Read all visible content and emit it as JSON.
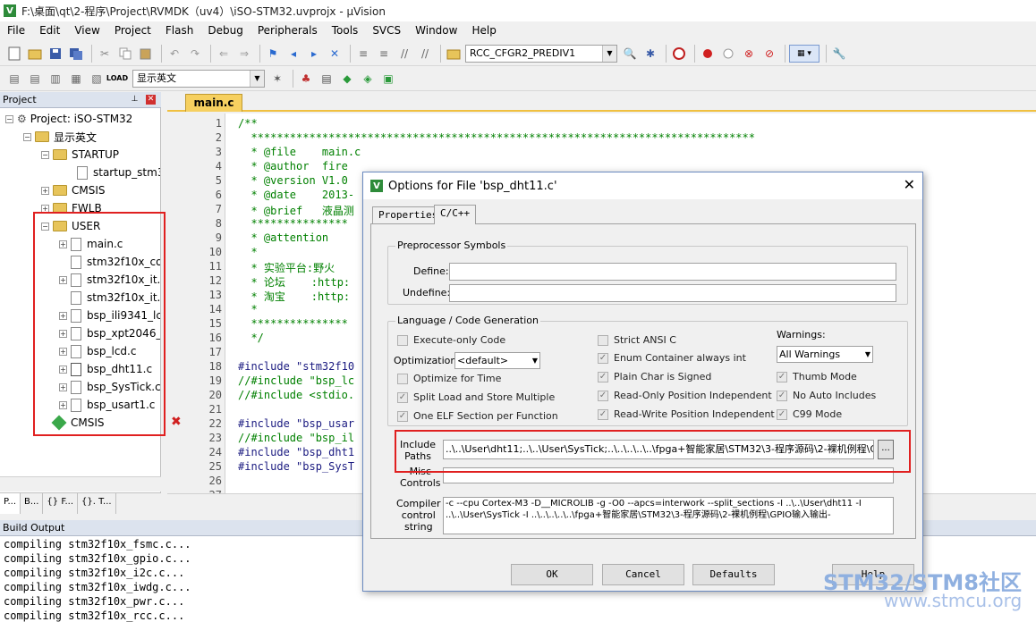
{
  "window": {
    "title": "F:\\桌面\\qt\\2-程序\\Project\\RVMDK（uv4）\\iSO-STM32.uvprojx - µVision"
  },
  "menu": [
    "File",
    "Edit",
    "View",
    "Project",
    "Flash",
    "Debug",
    "Peripherals",
    "Tools",
    "SVCS",
    "Window",
    "Help"
  ],
  "toolbar": {
    "target_combo": "RCC_CFGR2_PREDIV1",
    "group_combo": "显示英文"
  },
  "project_panel": {
    "title": "Project",
    "tree": {
      "root": "Project: iSO-STM32",
      "group": "显示英文",
      "startup": "STARTUP",
      "startup_file": "startup_stm32",
      "cmsis": "CMSIS",
      "fwlb": "FWLB",
      "user": "USER",
      "cmsis2": "CMSIS",
      "user_files": [
        "main.c",
        "stm32f10x_co",
        "stm32f10x_it.c",
        "stm32f10x_it.h",
        "bsp_ili9341_lc",
        "bsp_xpt2046_l",
        "bsp_lcd.c",
        "bsp_dht11.c",
        "bsp_SysTick.c",
        "bsp_usart1.c"
      ]
    },
    "tabs": [
      "P...",
      "B...",
      "{} F...",
      "{}. T..."
    ]
  },
  "editor": {
    "tab": "main.c",
    "lines": [
      {
        "n": "1",
        "t": "/**",
        "c": "cm"
      },
      {
        "n": "2",
        "t": "  ******************************************************************************",
        "c": "cm"
      },
      {
        "n": "3",
        "t": "  * @file    main.c",
        "c": "cm"
      },
      {
        "n": "4",
        "t": "  * @author  fire",
        "c": "cm"
      },
      {
        "n": "5",
        "t": "  * @version V1.0",
        "c": "cm"
      },
      {
        "n": "6",
        "t": "  * @date    2013-",
        "c": "cm"
      },
      {
        "n": "7",
        "t": "  * @brief   液晶测",
        "c": "cm"
      },
      {
        "n": "8",
        "t": "  ***************",
        "c": "cm"
      },
      {
        "n": "9",
        "t": "  * @attention",
        "c": "cm"
      },
      {
        "n": "10",
        "t": "  *",
        "c": "cm"
      },
      {
        "n": "11",
        "t": "  * 实验平台:野火",
        "c": "cm"
      },
      {
        "n": "12",
        "t": "  * 论坛    :http:",
        "c": "cm"
      },
      {
        "n": "13",
        "t": "  * 淘宝    :http:",
        "c": "cm"
      },
      {
        "n": "14",
        "t": "  *",
        "c": "cm"
      },
      {
        "n": "15",
        "t": "  ***************",
        "c": "cm"
      },
      {
        "n": "16",
        "t": "  */",
        "c": "cm"
      },
      {
        "n": "17",
        "t": "",
        "c": "pp"
      },
      {
        "n": "18",
        "t": "#include \"stm32f10",
        "c": "pp"
      },
      {
        "n": "19",
        "t": "//#include \"bsp_lc",
        "c": "cm"
      },
      {
        "n": "20",
        "t": "//#include <stdio.",
        "c": "cm"
      },
      {
        "n": "21",
        "t": "",
        "c": "pp"
      },
      {
        "n": "22",
        "t": "#include \"bsp_usar",
        "c": "pp"
      },
      {
        "n": "23",
        "t": "//#include \"bsp_il",
        "c": "cm"
      },
      {
        "n": "24",
        "t": "#include \"bsp_dht1",
        "c": "pp"
      },
      {
        "n": "25",
        "t": "#include \"bsp_SysT",
        "c": "pp"
      },
      {
        "n": "26",
        "t": "",
        "c": "pp"
      },
      {
        "n": "27",
        "t": "",
        "c": "pp"
      }
    ]
  },
  "build_output": {
    "title": "Build Output",
    "lines": [
      "compiling stm32f10x_fsmc.c...",
      "compiling stm32f10x_gpio.c...",
      "compiling stm32f10x_i2c.c...",
      "compiling stm32f10x_iwdg.c...",
      "compiling stm32f10x_pwr.c...",
      "compiling stm32f10x_rcc.c..."
    ]
  },
  "dialog": {
    "title": "Options for File 'bsp_dht11.c'",
    "tabs": [
      "Properties",
      "C/C++"
    ],
    "preprocessor": {
      "title": "Preprocessor Symbols",
      "define_label": "Define:",
      "undefine_label": "Undefine:",
      "define_value": "",
      "undefine_value": ""
    },
    "language": {
      "title": "Language / Code Generation",
      "execute_only": "Execute-only Code",
      "optimization_label": "Optimization:",
      "optimization_value": "<default>",
      "optimize_time": "Optimize for Time",
      "split_load": "Split Load and Store Multiple",
      "one_elf": "One ELF Section per Function",
      "strict_ansi": "Strict ANSI C",
      "enum_int": "Enum Container always int",
      "plain_char": "Plain Char is Signed",
      "ro_pos": "Read-Only Position Independent",
      "rw_pos": "Read-Write Position Independent",
      "warnings_label": "Warnings:",
      "warnings_value": "All Warnings",
      "thumb": "Thumb Mode",
      "no_auto": "No Auto Includes",
      "c99": "C99 Mode"
    },
    "include_label": "Include\nPaths",
    "include_value": "..\\..\\User\\dht11;..\\..\\User\\SysTick;..\\..\\..\\..\\..\\fpga+智能家居\\STM32\\3-程序源码\\2-裸机例程\\G",
    "misc_label": "Misc\nControls",
    "misc_value": "",
    "compiler_label": "Compiler\ncontrol\nstring",
    "compiler_value": "-c --cpu Cortex-M3 -D__MICROLIB -g -O0 --apcs=interwork --split_sections -I ..\\..\\User\\dht11 -I ..\\..\\User\\SysTick -I ..\\..\\..\\..\\..\\fpga+智能家居\\STM32\\3-程序源码\\2-裸机例程\\GPIO输入输出-",
    "buttons": {
      "ok": "OK",
      "cancel": "Cancel",
      "defaults": "Defaults",
      "help": "Help"
    }
  },
  "watermark": {
    "brand": "STM32/STM8社区",
    "url": "www.stmcu.org"
  }
}
